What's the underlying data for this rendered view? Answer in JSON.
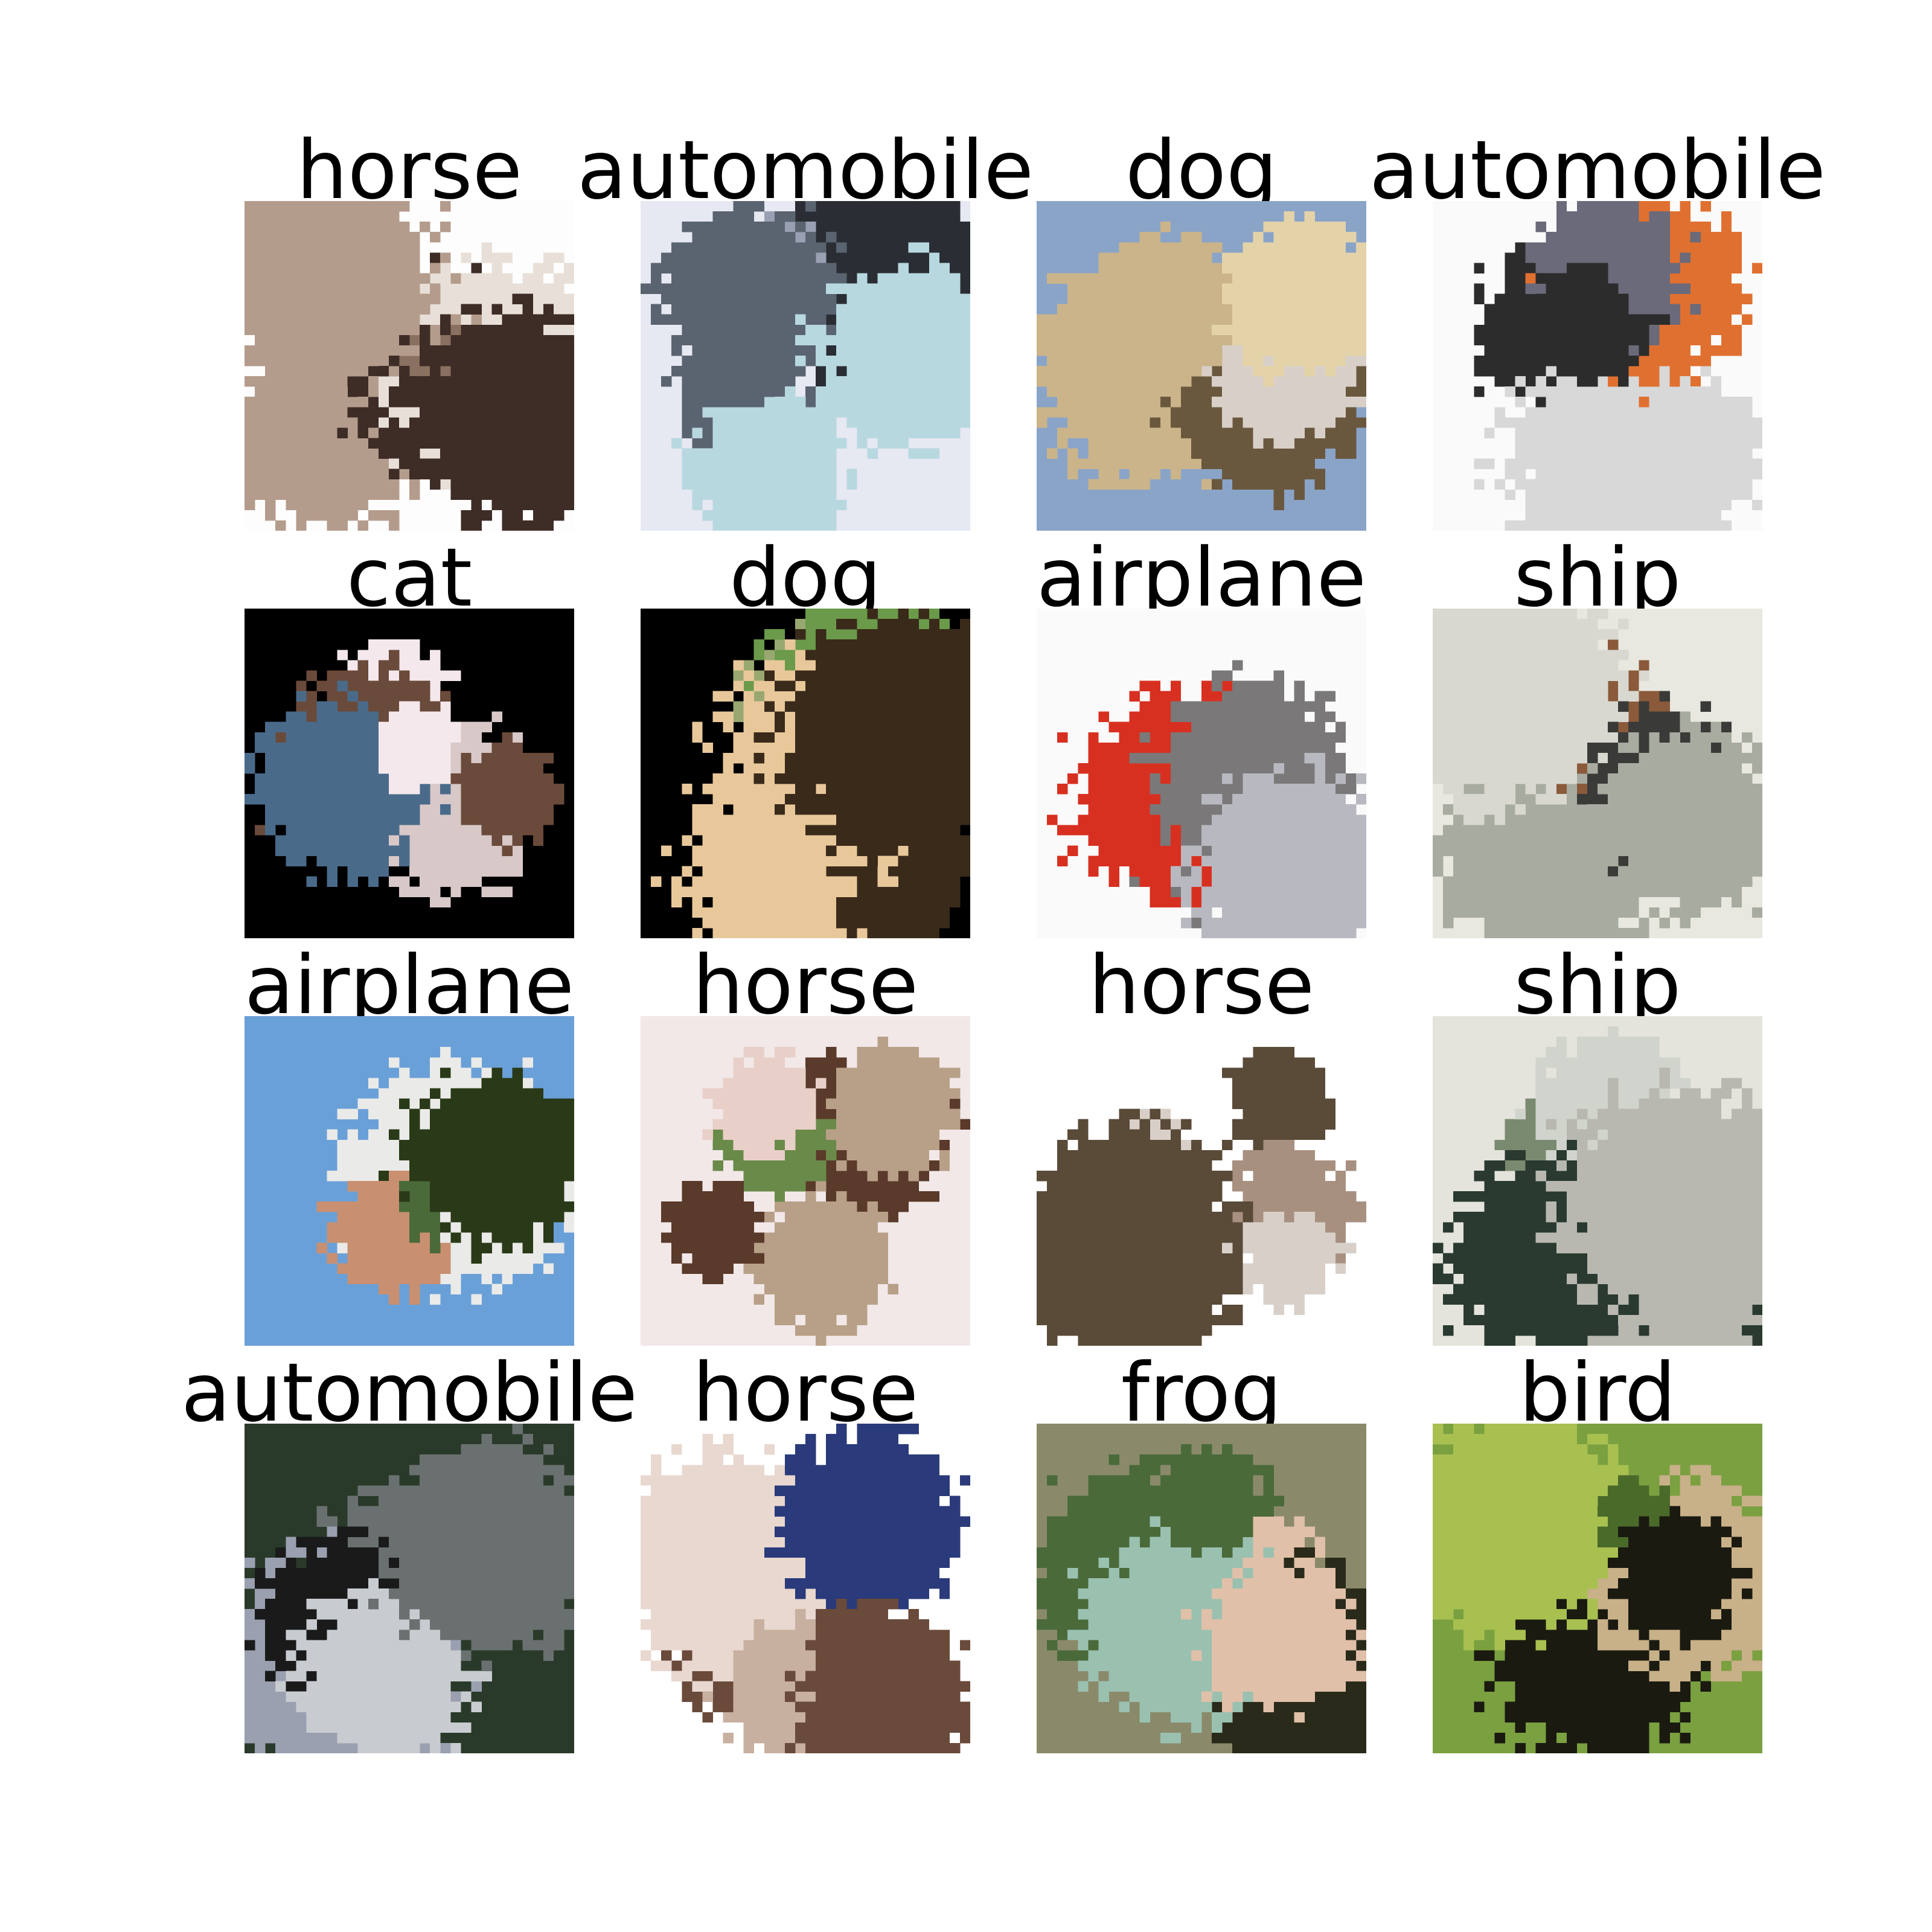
{
  "figure": {
    "items": [
      {
        "label": "horse",
        "palette": [
          "#fdfdfd",
          "#b49c8c",
          "#3e2c26",
          "#e8e0d8",
          "#8a7060"
        ]
      },
      {
        "label": "automobile",
        "palette": [
          "#e6e8f2",
          "#5a6470",
          "#b8d8e0",
          "#2a2e34",
          "#9aa0b4"
        ]
      },
      {
        "label": "dog",
        "palette": [
          "#8aa4c8",
          "#cbb48a",
          "#e4d2a8",
          "#6a583e",
          "#d8d0c8"
        ]
      },
      {
        "label": "automobile",
        "palette": [
          "#fafafa",
          "#2c2c2c",
          "#d8d8d8",
          "#e07030",
          "#6a6a7a"
        ]
      },
      {
        "label": "cat",
        "palette": [
          "#000000",
          "#f4e8ec",
          "#6a4a3a",
          "#d8c8c8",
          "#4a6a8a"
        ]
      },
      {
        "label": "dog",
        "palette": [
          "#000000",
          "#e8c89a",
          "#3a2a1a",
          "#98a870",
          "#6a9a4a"
        ]
      },
      {
        "label": "airplane",
        "palette": [
          "#fafafa",
          "#7a7878",
          "#b8b8c0",
          "#d8d0c8",
          "#d83020"
        ]
      },
      {
        "label": "ship",
        "palette": [
          "#e8e8e0",
          "#3a3a38",
          "#a8aca0",
          "#8a5a3a",
          "#d8d8d0"
        ]
      },
      {
        "label": "airplane",
        "palette": [
          "#6aa0d8",
          "#eaeae8",
          "#2a3a18",
          "#c89070",
          "#4a6a3a"
        ]
      },
      {
        "label": "horse",
        "palette": [
          "#f2e8e8",
          "#5a3a2a",
          "#b8a088",
          "#6a8a4a",
          "#e8d0c8"
        ]
      },
      {
        "label": "horse",
        "palette": [
          "#ffffff",
          "#5a4a38",
          "#d8d0c8",
          "#8aa070",
          "#a89080"
        ]
      },
      {
        "label": "ship",
        "palette": [
          "#e4e4dc",
          "#2a3a30",
          "#b8b8b0",
          "#7a8a70",
          "#d0d4cc"
        ]
      },
      {
        "label": "automobile",
        "palette": [
          "#2a3a2a",
          "#c8ccd0",
          "#6a7070",
          "#9aa0b0",
          "#1a1a1a"
        ]
      },
      {
        "label": "horse",
        "palette": [
          "#ffffff",
          "#c8b0a0",
          "#6a4a3a",
          "#e8d8d0",
          "#2a3a7a"
        ]
      },
      {
        "label": "frog",
        "palette": [
          "#8a8a6a",
          "#4a6a3a",
          "#e0c0a8",
          "#2a2a1a",
          "#9ac0b0"
        ]
      },
      {
        "label": "bird",
        "palette": [
          "#7aa040",
          "#4a6a2a",
          "#1a1a10",
          "#c8b088",
          "#a8c050"
        ]
      }
    ]
  }
}
